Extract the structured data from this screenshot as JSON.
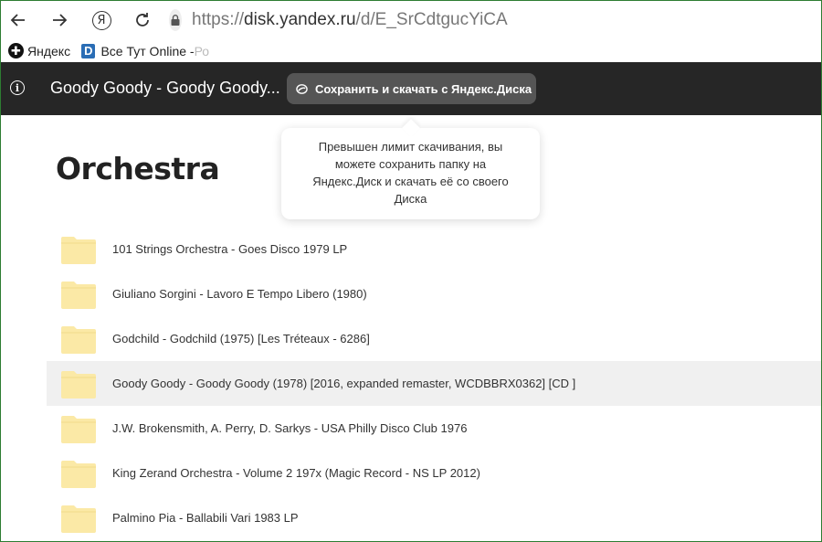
{
  "browser": {
    "url_domain": "disk.yandex.ru",
    "url_path": "/d/E_SrCdtgucYiCA",
    "url_scheme": "https://",
    "yandex_button_glyph": "Я"
  },
  "bookmarks": [
    {
      "label": "Яндекс",
      "icon": "yandex-icon"
    },
    {
      "label": "Все Тут Online - ",
      "label_fade": "Ро",
      "icon": "d-icon"
    }
  ],
  "header": {
    "title": "Goody Goody - Goody Goody...",
    "save_button": "Сохранить и скачать с Яндекс.Диска",
    "info_glyph": "i"
  },
  "tooltip": {
    "text": "Превышен лимит скачивания, вы можете сохранить папку на Яндекс.Диск и скачать её со своего Диска"
  },
  "folder": {
    "title": "Orchestra",
    "items": [
      {
        "name": "101 Strings Orchestra - Goes Disco 1979 LP"
      },
      {
        "name": "Giuliano Sorgini - Lavoro E Tempo Libero (1980)"
      },
      {
        "name": "Godchild - Godchild (1975) [Les Tréteaux - 6286]"
      },
      {
        "name": "Goody Goody - Goody Goody (1978) [2016, expanded remaster, WCDBBRX0362] [CD ]",
        "selected": true
      },
      {
        "name": "J.W. Brokensmith, A. Perry, D. Sarkys - USA Philly Disco Club 1976"
      },
      {
        "name": "King Zerand Orchestra - Volume 2 197x (Magic Record - NS LP 2012)"
      },
      {
        "name": "Palmino Pia - Ballabili Vari 1983 LP"
      }
    ]
  },
  "colors": {
    "header_bg": "#262626",
    "save_button_bg": "#555555",
    "folder_icon": "#fbe9a6",
    "selected_row_bg": "#f0f0f0"
  }
}
